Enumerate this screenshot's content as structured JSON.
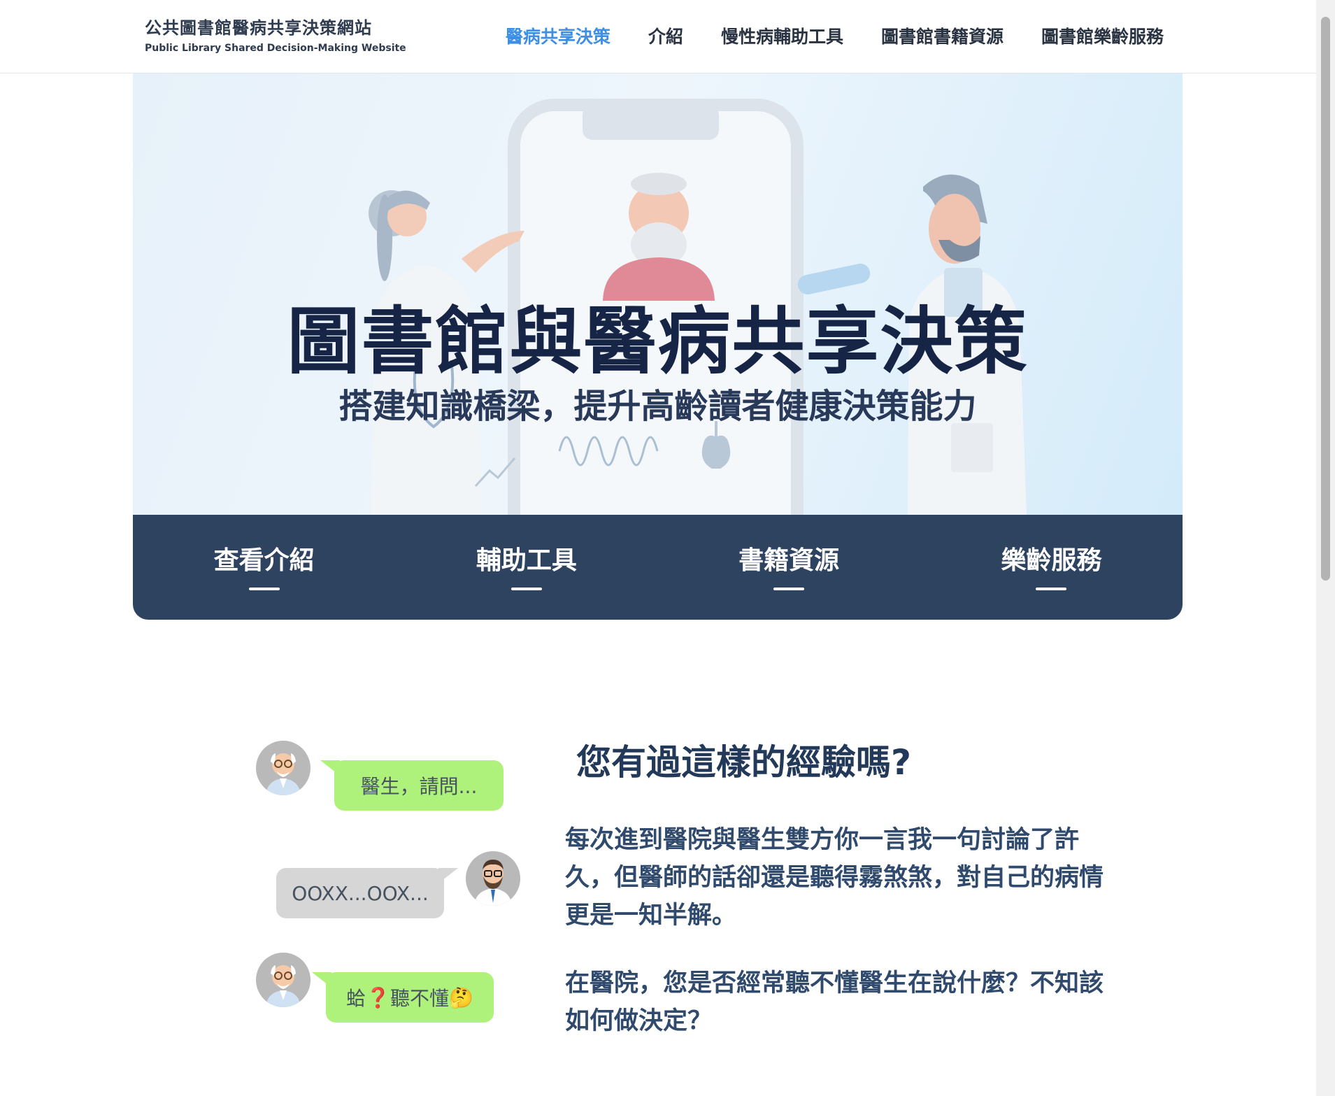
{
  "header": {
    "brand_zh": "公共圖書館醫病共享決策網站",
    "brand_en": "Public Library Shared Decision-Making Website",
    "nav": [
      {
        "label": "醫病共享決策",
        "active": true
      },
      {
        "label": "介紹",
        "active": false
      },
      {
        "label": "慢性病輔助工具",
        "active": false
      },
      {
        "label": "圖書館書籍資源",
        "active": false
      },
      {
        "label": "圖書館樂齡服務",
        "active": false
      }
    ]
  },
  "hero": {
    "title": "圖書館與醫病共享決策",
    "subtitle": "搭建知識橋梁，提升高齡讀者健康決策能力"
  },
  "quick_links": [
    {
      "label": "查看介紹"
    },
    {
      "label": "輔助工具"
    },
    {
      "label": "書籍資源"
    },
    {
      "label": "樂齡服務"
    }
  ],
  "chat": {
    "bubble1": "醫生，請問...",
    "bubble2": "OOXX...OOX...",
    "bubble3_prefix": "蛤",
    "bubble3_mark": "❓",
    "bubble3_text": "聽不懂",
    "bubble3_emoji": "🤔"
  },
  "section": {
    "heading": "您有過這樣的經驗嗎?",
    "paragraph1": "每次進到醫院與醫生雙方你一言我一句討論了許久，但醫師的話卻還是聽得霧煞煞，對自己的病情更是一知半解。",
    "paragraph2": "在醫院，您是否經常聽不懂醫生在說什麼？不知該如何做決定？"
  },
  "colors": {
    "nav_active": "#3d8fe6",
    "quick_band": "#2d4360",
    "patient_bubble": "#aef27b",
    "doctor_bubble": "#d6d6d6",
    "hero_title": "#162545"
  }
}
